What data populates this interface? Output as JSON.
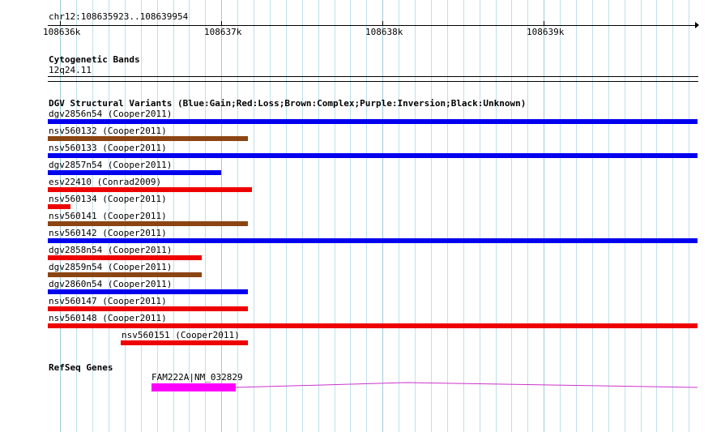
{
  "location": "chr12:108635923..108639954",
  "ruler": {
    "start": 108635923,
    "end": 108639954,
    "ticks": [
      {
        "label": "108636k",
        "value": 108636000
      },
      {
        "label": "108637k",
        "value": 108637000
      },
      {
        "label": "108638k",
        "value": 108638000
      },
      {
        "label": "108639k",
        "value": 108639000
      }
    ]
  },
  "cytobands": {
    "title": "Cytogenetic Bands",
    "band": "12q24.11"
  },
  "dgv": {
    "title": "DGV Structural Variants (Blue:Gain;Red:Loss;Brown:Complex;Purple:Inversion;Black:Unknown)",
    "colors": {
      "gain": "#0000ee",
      "loss": "#ee0000",
      "complex": "#8b4513",
      "inversion": "#800080",
      "unknown": "#000000"
    },
    "variants": [
      {
        "label": "dgv2856n54 (Cooper2011)",
        "type": "gain",
        "start": 108635923,
        "end": 108639954
      },
      {
        "label": "nsv560132 (Cooper2011)",
        "type": "complex",
        "start": 108635923,
        "end": 108637164
      },
      {
        "label": "nsv560133 (Cooper2011)",
        "type": "gain",
        "start": 108635923,
        "end": 108639954
      },
      {
        "label": "dgv2857n54 (Cooper2011)",
        "type": "gain",
        "start": 108635923,
        "end": 108636998
      },
      {
        "label": "esv22410 (Conrad2009)",
        "type": "loss",
        "start": 108635923,
        "end": 108637189
      },
      {
        "label": "nsv560134 (Cooper2011)",
        "type": "loss",
        "start": 108635923,
        "end": 108636063
      },
      {
        "label": "nsv560141 (Cooper2011)",
        "type": "complex",
        "start": 108635923,
        "end": 108637164
      },
      {
        "label": "nsv560142 (Cooper2011)",
        "type": "gain",
        "start": 108635923,
        "end": 108639954
      },
      {
        "label": "dgv2858n54 (Cooper2011)",
        "type": "loss",
        "start": 108635923,
        "end": 108636877
      },
      {
        "label": "dgv2859n54 (Cooper2011)",
        "type": "complex",
        "start": 108635923,
        "end": 108636877
      },
      {
        "label": "dgv2860n54 (Cooper2011)",
        "type": "gain",
        "start": 108635923,
        "end": 108637164
      },
      {
        "label": "nsv560147 (Cooper2011)",
        "type": "loss",
        "start": 108635923,
        "end": 108637164
      },
      {
        "label": "nsv560148 (Cooper2011)",
        "type": "loss",
        "start": 108635923,
        "end": 108639954
      },
      {
        "label": "nsv560151 (Cooper2011)",
        "type": "loss",
        "start": 108636375,
        "end": 108637164
      }
    ]
  },
  "refseq": {
    "title": "RefSeq Genes",
    "gene": {
      "label": "FAM222A|NM_032829",
      "exon_start": 108636566,
      "exon_end": 108637088,
      "intron_end": 108639954,
      "exon_color": "#ff00ff",
      "intron_color": "#cc33cc"
    }
  }
}
